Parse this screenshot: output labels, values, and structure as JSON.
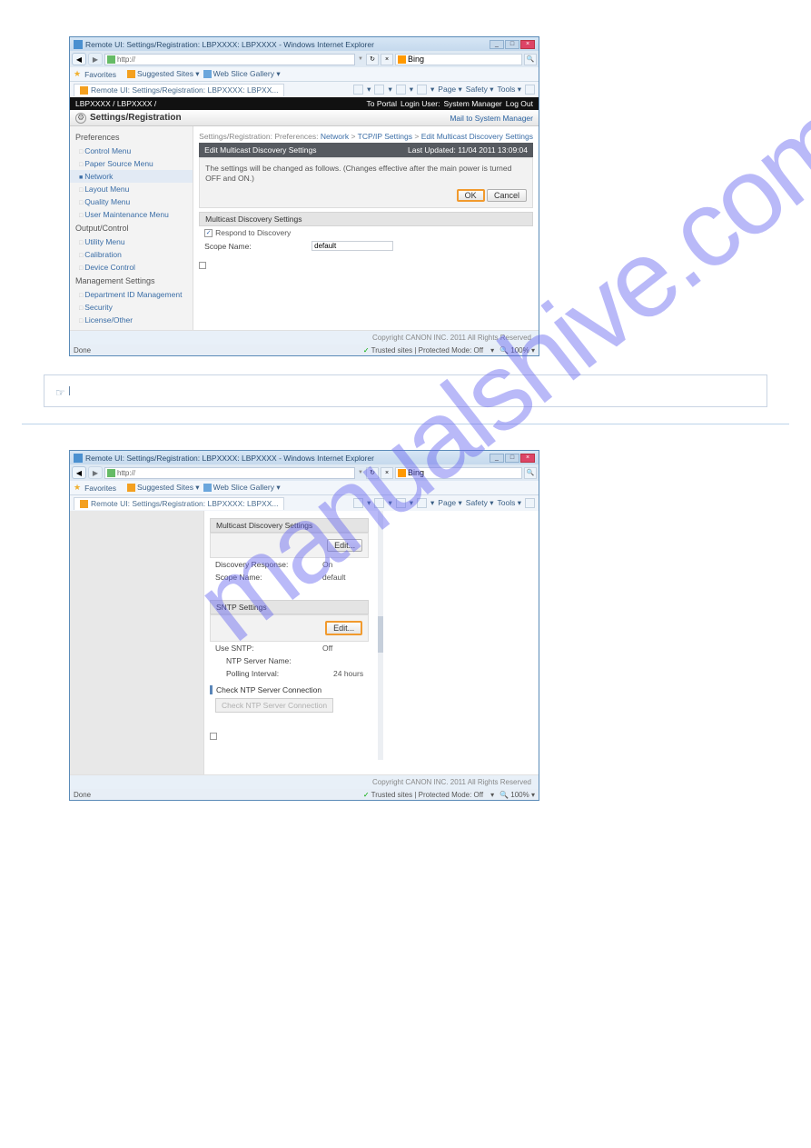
{
  "watermark": "manualshive.com",
  "window1": {
    "title": "Remote UI: Settings/Registration: LBPXXXX: LBPXXXX - Windows Internet Explorer",
    "address": "http://",
    "search_engine": "Bing",
    "favorites_label": "Favorites",
    "suggested_sites": "Suggested Sites ▾",
    "web_slice": "Web Slice Gallery ▾",
    "tab_label": "Remote UI: Settings/Registration: LBPXXXX: LBPXX...",
    "tools": {
      "page": "Page ▾",
      "safety": "Safety ▾",
      "tools": "Tools ▾"
    },
    "black_bar": {
      "device": "LBPXXXX / LBPXXXX /",
      "portal": "To Portal",
      "login": "Login User:",
      "user": "System Manager",
      "logout": "Log Out"
    },
    "settings_title": "Settings/Registration",
    "mail": "Mail to System Manager",
    "sidebar": {
      "groups": [
        {
          "head": "Preferences",
          "items": [
            "Control Menu",
            "Paper Source Menu",
            "Network",
            "Layout Menu",
            "Quality Menu",
            "User Maintenance Menu"
          ],
          "active_index": 2
        },
        {
          "head": "Output/Control",
          "items": [
            "Utility Menu",
            "Calibration",
            "Device Control"
          ]
        },
        {
          "head": "Management Settings",
          "items": [
            "Department ID Management",
            "Security",
            "License/Other"
          ]
        }
      ]
    },
    "breadcrumb": [
      "Settings/Registration:",
      "Preferences:",
      "Network",
      ">",
      "TCP/IP Settings",
      ">",
      "Edit Multicast Discovery Settings"
    ],
    "dark_head": "Edit Multicast Discovery Settings",
    "last_updated": "Last Updated: 11/04 2011 13:09:04",
    "note": "The settings will be changed as follows. (Changes effective after the main power is turned OFF and ON.)",
    "ok": "OK",
    "cancel": "Cancel",
    "section_head": "Multicast Discovery Settings",
    "respond": "Respond to Discovery",
    "scope_label": "Scope Name:",
    "scope_value": "default",
    "copyright": "Copyright CANON INC. 2011 All Rights Reserved",
    "status_done": "Done",
    "status_trusted": "Trusted sites | Protected Mode: Off",
    "status_zoom": "100%"
  },
  "window2": {
    "title": "Remote UI: Settings/Registration: LBPXXXX: LBPXXXX - Windows Internet Explorer",
    "address": "http://",
    "search_engine": "Bing",
    "favorites_label": "Favorites",
    "suggested_sites": "Suggested Sites ▾",
    "web_slice": "Web Slice Gallery ▾",
    "tab_label": "Remote UI: Settings/Registration: LBPXXXX: LBPXX...",
    "tools": {
      "page": "Page ▾",
      "safety": "Safety ▾",
      "tools": "Tools ▾"
    },
    "mds_head": "Multicast Discovery Settings",
    "edit_btn": "Edit...",
    "discovery_response_label": "Discovery Response:",
    "discovery_response_value": "On",
    "scope_label": "Scope Name:",
    "scope_value": "default",
    "sntp_head": "SNTP Settings",
    "use_sntp_label": "Use SNTP:",
    "use_sntp_value": "Off",
    "ntp_server_label": "NTP Server Name:",
    "poll_label": "Polling Interval:",
    "poll_value": "24 hours",
    "check_head": "Check NTP Server Connection",
    "check_btn": "Check NTP Server Connection",
    "copyright": "Copyright CANON INC. 2011 All Rights Reserved",
    "status_done": "Done",
    "status_trusted": "Trusted sites | Protected Mode: Off",
    "status_zoom": "100%"
  }
}
